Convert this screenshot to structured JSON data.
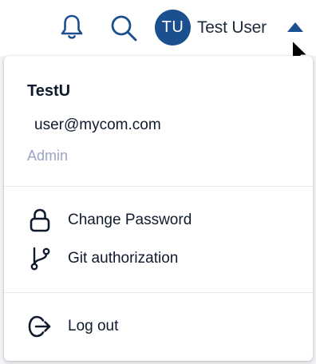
{
  "header": {
    "avatar_initials": "TU",
    "user_name": "Test User",
    "icons": [
      "bell-icon",
      "search-icon",
      "caret-up-icon"
    ]
  },
  "menu": {
    "name": "TestU",
    "email": "user@mycom.com",
    "role": "Admin",
    "items": [
      {
        "label": "Change Password",
        "icon": "lock-icon"
      },
      {
        "label": "Git authorization",
        "icon": "git-branch-icon"
      },
      {
        "label": "Log out",
        "icon": "logout-icon"
      }
    ]
  },
  "colors": {
    "accent": "#1b4f8f",
    "text": "#0f1b2d",
    "muted": "#9aa6c4",
    "divider": "#e6e8ee"
  }
}
